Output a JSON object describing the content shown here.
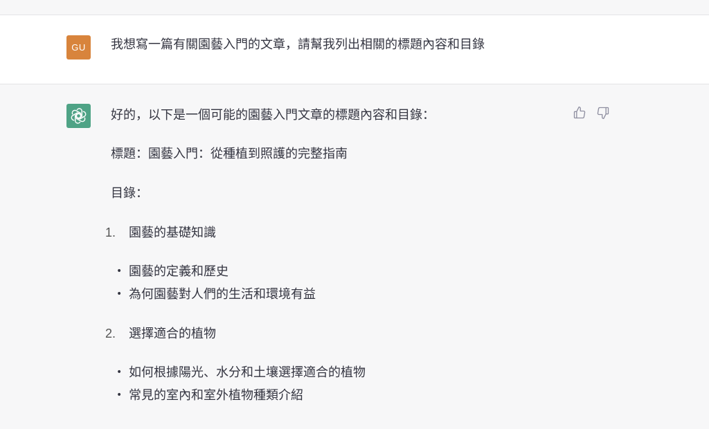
{
  "user": {
    "avatar_initials": "GU",
    "avatar_color": "#d8843c",
    "message": "我想寫一篇有關園藝入門的文章，請幫我列出相關的標題內容和目錄"
  },
  "assistant": {
    "avatar_icon": "openai-logo-icon",
    "avatar_color": "#4fa386",
    "feedback_icons": [
      "thumbs-up-icon",
      "thumbs-down-icon"
    ],
    "intro": "好的，以下是一個可能的園藝入門文章的標題內容和目錄：",
    "title_line": "標題：園藝入門：從種植到照護的完整指南",
    "toc_label": "目錄：",
    "sections": [
      {
        "number": "1.",
        "title": "園藝的基礎知識",
        "bullets": [
          "園藝的定義和歷史",
          "為何園藝對人們的生活和環境有益"
        ]
      },
      {
        "number": "2.",
        "title": "選擇適合的植物",
        "bullets": [
          "如何根據陽光、水分和土壤選擇適合的植物",
          "常見的室內和室外植物種類介紹"
        ]
      }
    ]
  }
}
